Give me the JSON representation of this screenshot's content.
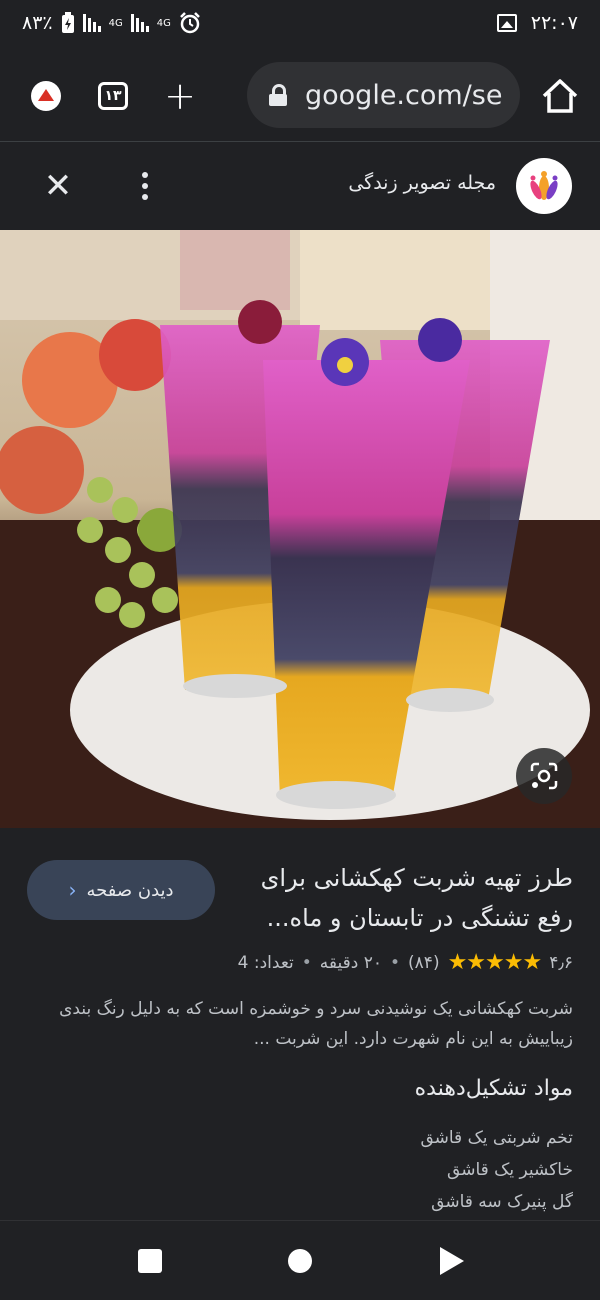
{
  "status_bar": {
    "battery": "٨٣٪",
    "network": "4G",
    "time": "۲۲:۰۷"
  },
  "browser": {
    "tab_count": "۱۳",
    "url": "google.com/se",
    "icons": [
      "update-icon",
      "tabs-icon",
      "new-tab-icon",
      "lock-icon",
      "home-icon"
    ]
  },
  "sheet": {
    "site_name": "مجله تصویر زندگی",
    "icons": [
      "close-icon",
      "more-vert-icon",
      "site-logo"
    ]
  },
  "result": {
    "view_page_label": "دیدن صفحه",
    "title": "طرز تهیه شربت کهکشانی برای رفع تشنگی در تابستان و ماه...",
    "rating_value": "۴٫۶",
    "stars": "★★★★★",
    "reviews": "(۸۴)",
    "duration": "۲۰ دقیقه",
    "servings": "تعداد: 4",
    "description": "شربت کهکشانی یک نوشیدنی سرد و خوشمزه است که به دلیل رنگ بندی زیباییش به این نام شهرت دارد. این شربت ...",
    "ingredients_heading": "مواد تشکیل‌دهنده",
    "ingredients": [
      "تخم شربتی یک قاشق",
      "خاکشیر یک قاشق",
      "گل پنیرک سه قاشق"
    ]
  },
  "colors": {
    "background": "#202124",
    "button": "#394457",
    "star": "#fbbc04",
    "accent": "#8ab4f8"
  }
}
